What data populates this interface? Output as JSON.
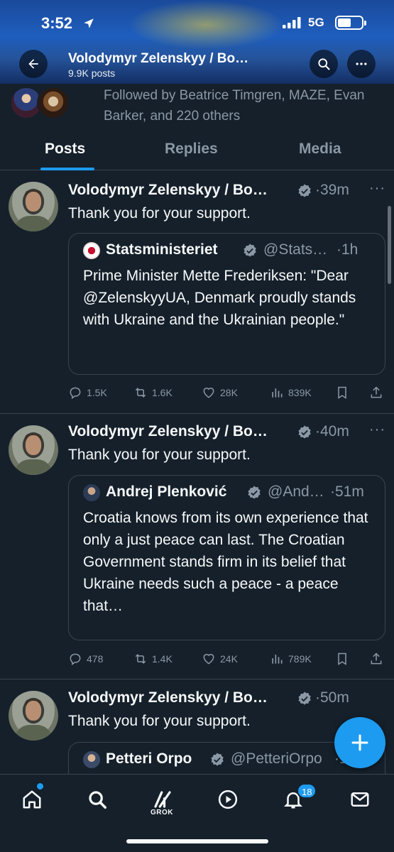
{
  "status": {
    "time": "3:52",
    "network": "5G"
  },
  "header": {
    "title": "Volodymyr Zelenskyy / Bo…",
    "subtitle": "9.9K posts"
  },
  "followed": {
    "text": "Followed by Beatrice Timgren, MAZE, Evan Barker, and 220 others"
  },
  "tabs": [
    {
      "label": "Posts"
    },
    {
      "label": "Replies"
    },
    {
      "label": "Media"
    }
  ],
  "posts": [
    {
      "name": "Volodymyr Zelenskyy / Bo…",
      "time": "·39m",
      "text": "Thank you for your support.",
      "quote": {
        "name": "Statsministeriet",
        "handle": "@Stats…",
        "time": "·1h",
        "text": "Prime Minister Mette Frederiksen: \"Dear @ZelenskyyUA, Denmark proudly stands with Ukraine and the Ukrainian people.\""
      },
      "stats": {
        "replies": "1.5K",
        "reposts": "1.6K",
        "likes": "28K",
        "views": "839K"
      }
    },
    {
      "name": "Volodymyr Zelenskyy / Bo…",
      "time": "·40m",
      "text": "Thank you for your support.",
      "quote": {
        "name": "Andrej Plenković",
        "handle": "@And…",
        "time": "·51m",
        "text": "Croatia knows from its own experience that only a just peace can last. The Croatian Government stands firm in its belief that Ukraine needs such a peace - a peace that…"
      },
      "stats": {
        "replies": "478",
        "reposts": "1.4K",
        "likes": "24K",
        "views": "789K"
      }
    },
    {
      "name": "Volodymyr Zelenskyy / Bo…",
      "time": "·50m",
      "text": "Thank you for your support.",
      "quote": {
        "name": "Petteri Orpo",
        "handle": "@PetteriOrpo",
        "time": "·1h"
      }
    }
  ],
  "bottom_nav": {
    "grok_label": "GROK",
    "notifications_badge": "18"
  },
  "colors": {
    "background": "#15202b",
    "accent": "#1d9bf0",
    "muted": "#8b98a5",
    "border": "#38444d"
  }
}
